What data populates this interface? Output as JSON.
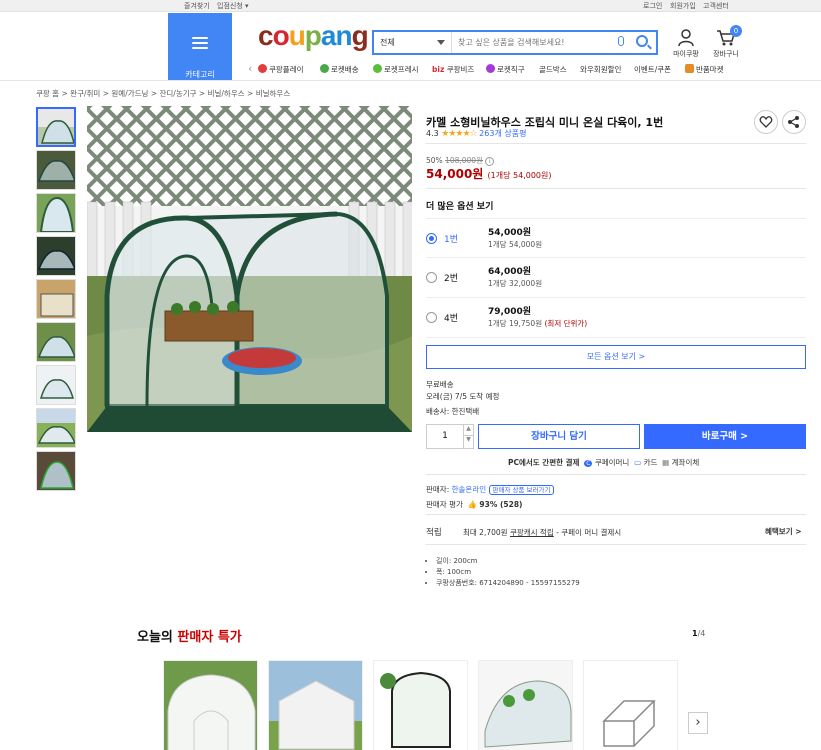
{
  "topbar": {
    "left": [
      "즐겨찾기",
      "입점신청 ▾"
    ],
    "right": [
      "로그인",
      "회원가입",
      "고객센터"
    ]
  },
  "header": {
    "category_label": "카테고리",
    "logo": "coupang",
    "search_category": "전체",
    "search_placeholder": "찾고 싶은 상품을 검색해보세요!",
    "mycoupang": "마이쿠팡",
    "cart": "장바구니",
    "cart_count": "0"
  },
  "nav_links": [
    "쿠팡플레이",
    "로켓배송",
    "로켓프레시",
    "쿠팡비즈",
    "로켓직구",
    "골드박스",
    "와우회원할인",
    "이벤트/쿠폰",
    "반품마켓"
  ],
  "nav_biz_prefix": "biz",
  "breadcrumb": [
    "쿠팡 홈",
    "완구/취미",
    "원예/가드닝",
    "잔디/농기구",
    "비닐/하우스",
    "비닐하우스"
  ],
  "breadcrumb_sep": ">",
  "product": {
    "title": "카멜 소형비닐하우스 조립식 미니 온실 다육이, 1번",
    "rating": "4.3",
    "stars": "★★★★☆",
    "review_count": "263개 상품평",
    "discount": "50%",
    "original_price": "108,000원",
    "info_mark": "i",
    "price": "54,000원",
    "unit_price": "(1개당 54,000원)",
    "more_options_title": "더 많은 옵션 보기",
    "options": [
      {
        "name": "1번",
        "price": "54,000원",
        "unit": "1개당 54,000원",
        "note": "",
        "selected": true
      },
      {
        "name": "2번",
        "price": "64,000원",
        "unit": "1개당 32,000원",
        "note": "",
        "selected": false
      },
      {
        "name": "4번",
        "price": "79,000원",
        "unit": "1개당 19,750원",
        "note": "(최저 단위가)",
        "selected": false
      }
    ],
    "all_options_button": "모든 옵션 보기 >",
    "shipping_free": "무료배송",
    "delivery_date": "오레(금) 7/5 도착 예정",
    "shipping_company": "배송사: 한진택배",
    "quantity": "1",
    "add_to_cart": "장바구니 담기",
    "buy_now": "바로구매 >",
    "payment_prefix": "PC에서도 간편한 결제",
    "payment_methods": [
      "쿠페이머니",
      "카드",
      "계좌이체"
    ],
    "payment_icons": [
      "C",
      "▭",
      "▦"
    ],
    "seller_label": "판매자:",
    "seller_name": "한솔온라인",
    "seller_link": "판매자 상품 보러가기",
    "seller_rating_label": "판매자 평가",
    "seller_rating_value": "93% (528)",
    "seller_rating_icon": "👍",
    "benefit_label": "적립",
    "benefit_prefix": "최대 2,700원",
    "benefit_link": "쿠팡캐시 적립",
    "benefit_suffix": "- 쿠페이 머니 결제시",
    "benefit_more": "혜택보기 >",
    "specs": [
      "길이: 200cm",
      "폭: 100cm",
      "쿠팡상품번호: 6714204890 - 15597155279"
    ]
  },
  "deals": {
    "title_prefix": "오늘의",
    "title_highlight": "판매자 특가",
    "page_current": "1",
    "page_total": "/4",
    "next_icon": "›"
  },
  "colors": {
    "brand_blue": "#4285f4",
    "accent_blue": "#346aff",
    "price_red": "#ae0000",
    "deal_red": "#cc0000",
    "logo_letters": [
      "#8b2d1e",
      "#d7262e",
      "#f4a01a",
      "#7bb043",
      "#1f8bd6",
      "#1f8bd6",
      "#8b2d1e"
    ]
  }
}
